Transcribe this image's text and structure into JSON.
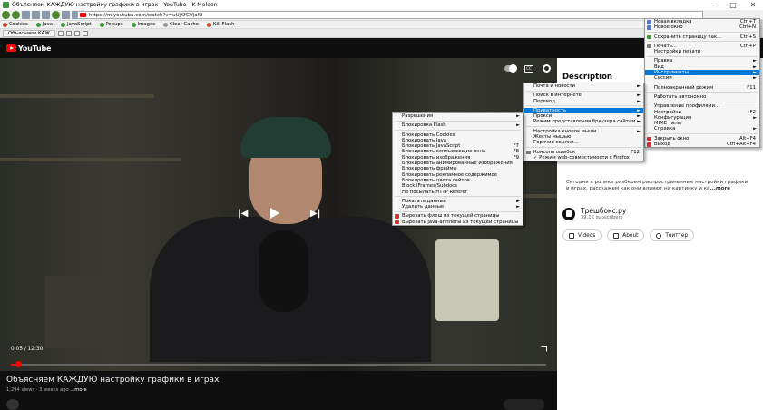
{
  "window": {
    "title": "Объясняем КАЖДУЮ настройку графики в играх - YouTube - K-Meleon",
    "minimize": "–",
    "maximize": "□",
    "close": "✕"
  },
  "address": {
    "url": "https://m.youtube.com/watch?v=uUjKfGVjaIU"
  },
  "toolbar": {
    "items": [
      "Cookies",
      "Java",
      "JavaScript",
      "Popups",
      "Images",
      "Clear Cache",
      "Kill Flash"
    ]
  },
  "tab": {
    "label": "Объясняем КАЖ..."
  },
  "youtube": {
    "logo": "YouTube"
  },
  "player": {
    "time": "0:05 / 12:30",
    "cc": "CC",
    "progress": 0.007
  },
  "video_info": {
    "title": "Объясняем КАЖДУЮ настройку графики в играх",
    "views_age": "1,294 views · 3 weeks ago",
    "more": "...more"
  },
  "side": {
    "description_heading": "Description",
    "desc_text": "Сегодня в ролике разберем распространенные настройки графики в играх, расскажем как они влияют на картинку и ка",
    "desc_more": "...more",
    "channel_name": "Трешбокс.ру",
    "channel_subs": "39.1K subscribers",
    "btn_videos": "Videos",
    "btn_about": "About",
    "btn_twitter": "Твиттер"
  },
  "menu_main": [
    {
      "label": "Новая вкладка",
      "shortcut": "Ctrl+T",
      "icon": "#4a7ad8"
    },
    {
      "label": "Новое окно",
      "shortcut": "Ctrl+N",
      "icon": "#4a7ad8"
    },
    {
      "sep": true
    },
    {
      "label": "Сохранить страницу как...",
      "shortcut": "Ctrl+S",
      "icon": "#3a9a3a"
    },
    {
      "sep": true
    },
    {
      "label": "Печать...",
      "shortcut": "Ctrl+P",
      "icon": "#777"
    },
    {
      "label": "Настройки печати",
      "shortcut": ""
    },
    {
      "sep": true
    },
    {
      "label": "Правка",
      "arrow": true
    },
    {
      "label": "Вид",
      "arrow": true
    },
    {
      "label": "Инструменты",
      "arrow": true,
      "hl": true
    },
    {
      "label": "Сессии",
      "arrow": true
    },
    {
      "sep": true
    },
    {
      "label": "Полноэкранный режим",
      "shortcut": "F11"
    },
    {
      "sep": true
    },
    {
      "label": "Работать автономно",
      "shortcut": ""
    },
    {
      "sep": true
    },
    {
      "label": "Управление профилями...",
      "shortcut": ""
    },
    {
      "label": "Настройки",
      "shortcut": "F2"
    },
    {
      "label": "Конфигурация",
      "arrow": true
    },
    {
      "label": "MIME типы",
      "shortcut": ""
    },
    {
      "label": "Справка",
      "arrow": true
    },
    {
      "sep": true
    },
    {
      "label": "Закрыть окно",
      "shortcut": "Alt+F4",
      "icon": "#c33"
    },
    {
      "label": "Выход",
      "shortcut": "Ctrl+Alt+F4",
      "icon": "#c33"
    }
  ],
  "menu_tools": [
    {
      "label": "Почта и новости",
      "arrow": true
    },
    {
      "sep": true
    },
    {
      "label": "Поиск в интернете",
      "arrow": true
    },
    {
      "label": "Перевод",
      "arrow": true
    },
    {
      "sep": true
    },
    {
      "label": "Приватность",
      "arrow": true,
      "hl": true
    },
    {
      "label": "Прокси",
      "arrow": true
    },
    {
      "label": "Режим представления браузера сайтам",
      "arrow": true
    },
    {
      "sep": true
    },
    {
      "label": "Настройка кнопок мыши",
      "arrow": true
    },
    {
      "label": "Жесты мышью",
      "shortcut": ""
    },
    {
      "label": "Горячие ссылки...",
      "shortcut": ""
    },
    {
      "sep": true
    },
    {
      "label": "Консоль ошибок",
      "shortcut": "F12",
      "icon": "#777"
    },
    {
      "label": "✓ Режим web-совместимости с Firefox",
      "shortcut": ""
    }
  ],
  "menu_privacy": [
    {
      "label": "Разрешения",
      "arrow": true
    },
    {
      "sep": true
    },
    {
      "label": "Блокировка Flash",
      "arrow": true
    },
    {
      "sep": true
    },
    {
      "label": "Блокировать Cookies",
      "shortcut": ""
    },
    {
      "label": "Блокировать Java",
      "shortcut": ""
    },
    {
      "label": "Блокировать JavaScript",
      "shortcut": "F7"
    },
    {
      "label": "Блокировать всплывающие окна",
      "shortcut": "F8"
    },
    {
      "label": "Блокировать изображения",
      "shortcut": "F9"
    },
    {
      "label": "Блокировать анимированные изображения",
      "shortcut": ""
    },
    {
      "label": "Блокировать фреймы",
      "shortcut": ""
    },
    {
      "label": "Блокировать рекламное содержимое",
      "shortcut": ""
    },
    {
      "label": "Блокировать цвета сайтов",
      "shortcut": ""
    },
    {
      "label": "Block IFrames/Subdocs",
      "shortcut": ""
    },
    {
      "label": "Не посылать HTTP Referer",
      "shortcut": ""
    },
    {
      "sep": true
    },
    {
      "label": "Показать данные",
      "arrow": true
    },
    {
      "label": "Удалить данные",
      "arrow": true
    },
    {
      "sep": true
    },
    {
      "label": "Вырезать флеш из текущей страницы",
      "shortcut": "",
      "icon": "#c33"
    },
    {
      "label": "Вырезать java-апплеты из текущей страницы",
      "shortcut": "",
      "icon": "#c33"
    }
  ]
}
